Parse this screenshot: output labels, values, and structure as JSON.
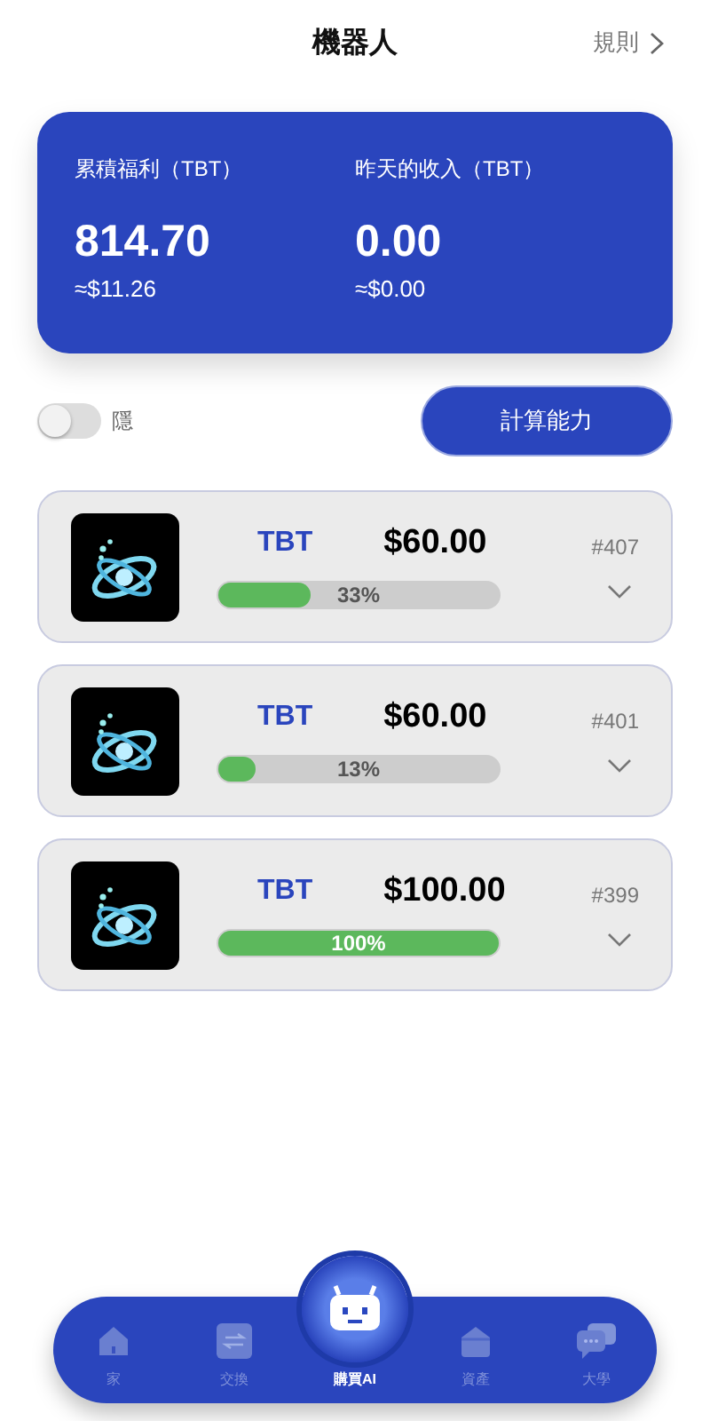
{
  "header": {
    "title": "機器人",
    "rules_link": "規則"
  },
  "summary": {
    "items": [
      {
        "label": "累積福利（TBT）",
        "value": "814.70",
        "approx": "≈$11.26"
      },
      {
        "label": "昨天的收入（TBT）",
        "value": "0.00",
        "approx": "≈$0.00"
      }
    ]
  },
  "controls": {
    "toggle": {
      "label": "隱",
      "on": false
    },
    "button": "計算能力"
  },
  "robots": [
    {
      "token": "TBT",
      "price": "$60.00",
      "id": "#407",
      "level": 0.33,
      "percent": "33%"
    },
    {
      "token": "TBT",
      "price": "$60.00",
      "id": "#401",
      "level": 0.13,
      "percent": "13%"
    },
    {
      "token": "TBT",
      "price": "$100.00",
      "id": "#399",
      "level": 1,
      "percent": "100%"
    }
  ],
  "nav": [
    {
      "label": "家",
      "selected": false
    },
    {
      "label": "交換",
      "selected": false
    },
    {
      "label": "購買AI",
      "selected": true
    },
    {
      "label": "資產",
      "selected": false
    },
    {
      "label": "大學",
      "selected": false
    }
  ]
}
